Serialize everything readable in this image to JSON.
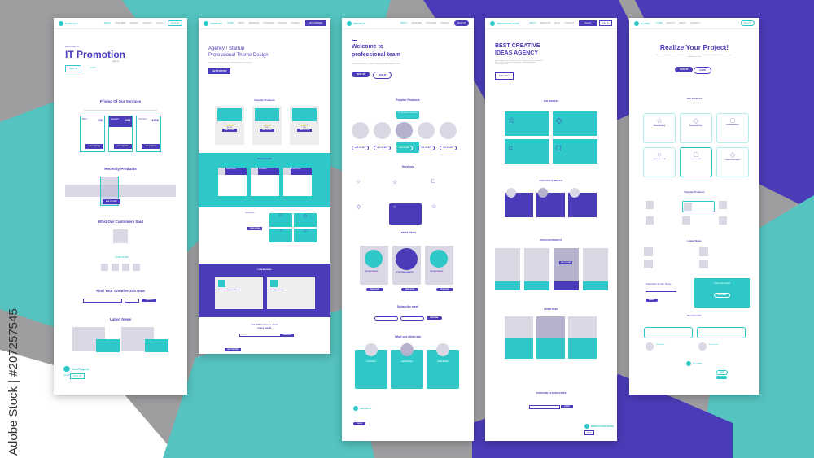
{
  "watermark": "Adobe Stock | #207257545",
  "colors": {
    "teal": "#2ec8c8",
    "purple": "#4a3bb8",
    "gray": "#d9d8e4",
    "background": "#9e9ea1"
  },
  "page1": {
    "logo": "DevProject",
    "nav": [
      "ABOUT",
      "FEATURES",
      "PRICING",
      "CONTACT"
    ],
    "nav_login": "LOGIN",
    "nav_signup": "SIGN UP",
    "eyebrow": "WELCOME TO",
    "title": "IT Promotion",
    "subtitle": "Agency",
    "signup": "SIGN UP",
    "login": "LOGIN",
    "pricing_title": "Pricing Of Our Services",
    "plans": [
      {
        "name": "Basic",
        "price": "9$",
        "button": "GET STARTED"
      },
      {
        "name": "Standard",
        "price": "49$",
        "button": "GET STARTED"
      },
      {
        "name": "Premium",
        "price": "199$",
        "button": "GET STARTED"
      }
    ],
    "recent_title": "Recently Products",
    "add_to_cart": "ADD TO CART",
    "customers_title": "What Our Customers Said",
    "learn_more": "LEARN MORE",
    "job_title": "Find Your Creative Job Now",
    "search": "SEARCH",
    "news_title": "Latest News",
    "footer_login": "LOGIN",
    "footer_signup": "SIGN UP"
  },
  "page2": {
    "logo": "COMPANY",
    "nav": [
      "HOME",
      "ABOUT",
      "SERVICES",
      "FEATURES",
      "PRICING",
      "CONTACT"
    ],
    "nav_button": "GET STARTED",
    "title_line1": "Agency / Startup",
    "title_line2": "Professional Theme Design",
    "tagline": "ONLINE MONITORING OPTIMIZATION TOOLS",
    "cta": "GET STARTED",
    "popular_title": "Popular Products",
    "products": [
      {
        "name": "Etiam accumsan",
        "price": "$15.00",
        "button": "Add To Cart"
      },
      {
        "name": "Euismod lorem",
        "price": "$11",
        "button": "Add To Cart"
      },
      {
        "name": "Nullam sit amet",
        "price": "$18",
        "button": "Add To Cart"
      }
    ],
    "testimonials_title": "Testimonials",
    "testimonials": [
      {
        "name": "Harper Taylor",
        "role": "CEO / Client"
      },
      {
        "name": "Mia Wilson",
        "role": "Customer Support"
      },
      {
        "name": "Emma Davis",
        "role": "Web Developer"
      }
    ],
    "services_title": "Services",
    "read_more": "READ MORE",
    "service_tiles": [
      "Social Media",
      "Development",
      "Design",
      "Search Engine Optimization"
    ],
    "latest_title": "Latest news",
    "news": [
      {
        "title": "Nonummy aliquam nibh sed",
        "link": "Read More"
      },
      {
        "title": "Sed diam sit amet",
        "link": "Read More"
      }
    ],
    "newsletter_line1": "Get 100 business ideas",
    "newsletter_line2": "every week!",
    "newsletter_placeholder": "Your Email",
    "subscribe": "Subscribe",
    "footer_button": "GET STARTED"
  },
  "page3": {
    "logo": "PROJECT",
    "nav": [
      "ABOUT",
      "SERVICES",
      "FEATURES",
      "PRICING"
    ],
    "nav_button": "SIGN UP",
    "title_line1": "Welcome to",
    "title_line2": "professional team",
    "tagline": "Great experience, online monitoring optimization tools",
    "signup": "SIGN UP",
    "signin": "SIGN IN",
    "popular_title": "Popular Products",
    "featured_label": "UIT WORKING SMARTER",
    "add_to_cart": "ADD TO CART",
    "services_title": "Services",
    "latest_title": "Latest News",
    "news": [
      "TEXLAB POSITION",
      "UIT WORKING SMARTER",
      "TEXLAB POSITION"
    ],
    "read_more": "READ MORE",
    "subscribe_title": "Subscribe now!",
    "subscribe_button": "SUBSCRIBE",
    "client_title": "What our client say",
    "clients": [
      "LUCIA SMITH",
      "MARIA BROWN",
      "JENNA BROWN"
    ],
    "footer_button": "SIGN UP"
  },
  "page4": {
    "logo": "INNOVATION TEAM",
    "nav": [
      "ABOUT",
      "SERVICES",
      "BLOG",
      "CONTACT"
    ],
    "nav_search": "Search",
    "nav_login": "Sign In",
    "title_line1": "BEST CREATIVE",
    "title_line2": "IDEAS AGENCY",
    "tagline": "Modern Agency, Professional Team, Great Expe rience, Innovation Idea, Creative Process, IT Promotion, Online Monitoring, Optimization Tools",
    "learn_more": "Learn More",
    "services_title": "OUR SERVICES",
    "read_more": "READ MORE",
    "client_title": "WHAT OUR CLIENT SAY",
    "popular_title": "POPULAR PRODUCTS",
    "add_to_cart": "ADD TO CART",
    "latest_title": "LATEST NEWS",
    "newsletter_title": "SUBSCRIBE TO NEWSLETTER",
    "newsletter_button": "SUBMIT",
    "footer_button": "Sign In"
  },
  "page5": {
    "logo": "DevTEK",
    "nav": [
      "HOME",
      "PRICING",
      "ABOUT",
      "CONTACT"
    ],
    "nav_button": "SIGN IN",
    "title": "Realize Your Project!",
    "tagline": "Modern Agency, Professional Team, Great Experience, Innovation Idea, IT Promotion, Online Monitoring, Optimization Tools",
    "signup": "SIGN UP",
    "login": "LOGIN",
    "services_title": "Our Services",
    "services": [
      "Online Marketing",
      "Professional Team",
      "Great Experience",
      "Optimization Tools",
      "Innovation Idea",
      "Realize Your Project"
    ],
    "popular_title": "Popular Products",
    "latest_title": "Latest News",
    "subscribe_title": "Subscribe To Our News",
    "subscribe_button": "SUBMIT",
    "promo_title": "Lorem ipsum dolor",
    "promo_button": "READ MORE",
    "testimonials_title": "Testimonials",
    "testimonial_names": [
      "Olivia Miller",
      "Emma Davis"
    ],
    "footer_login": "LOGIN",
    "footer_signup": "SIGN UP"
  }
}
